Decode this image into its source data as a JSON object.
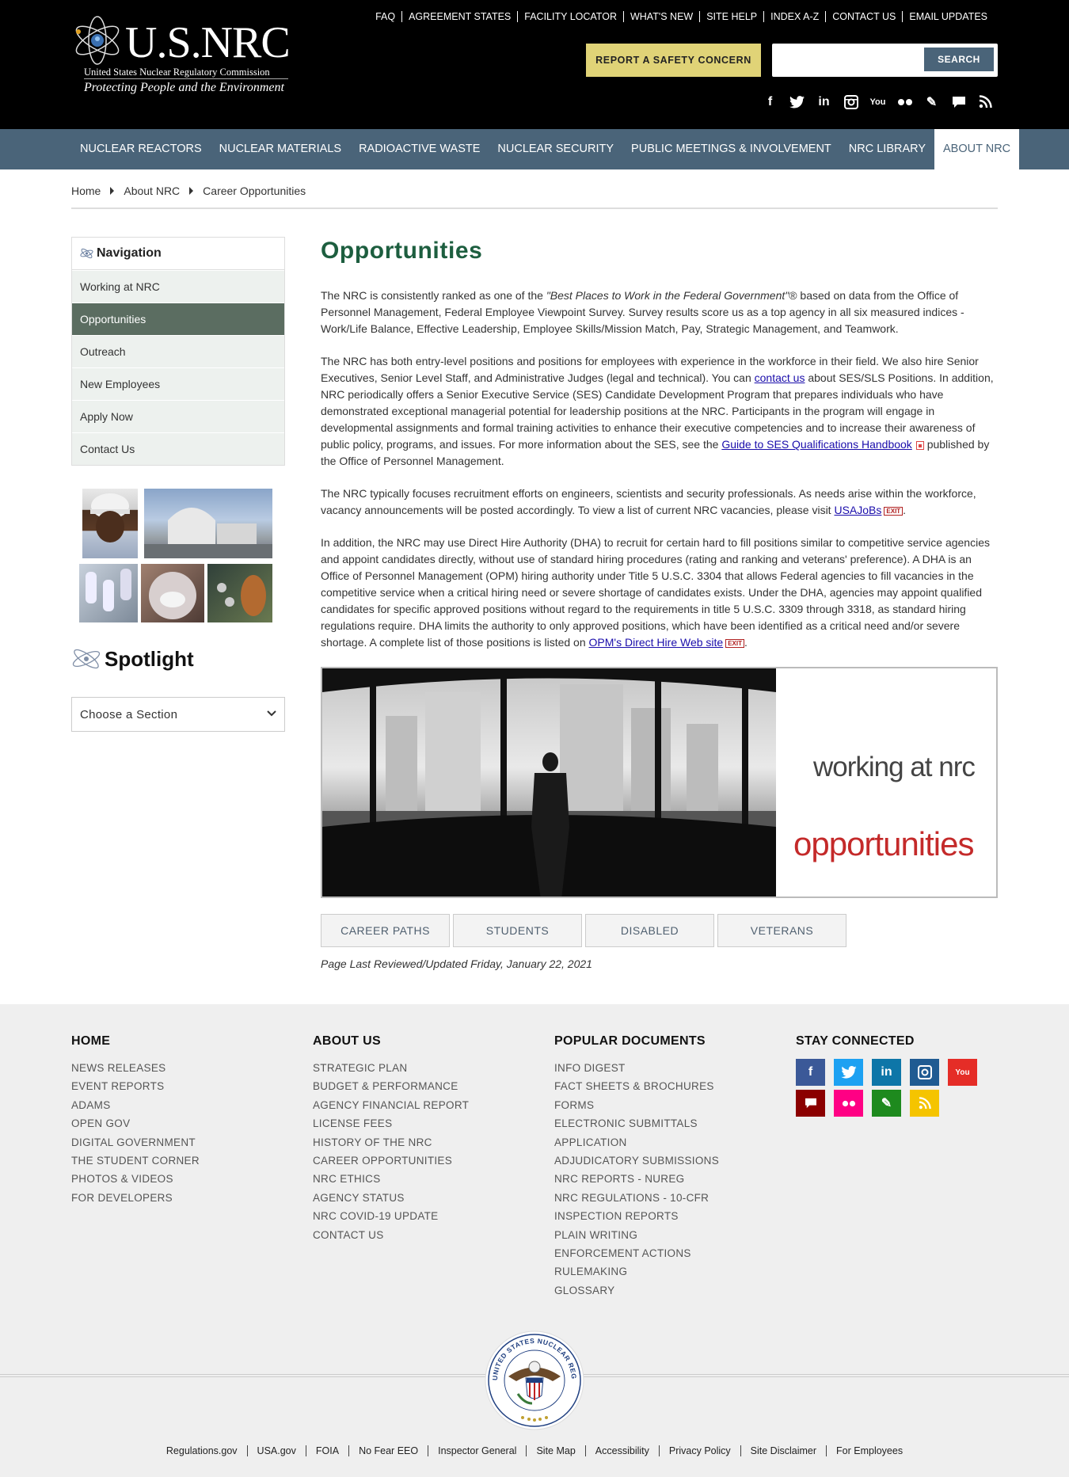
{
  "header": {
    "logo_text": "U.S.NRC",
    "logo_subtitle": "United States Nuclear Regulatory Commission",
    "logo_tagline": "Protecting People and the Environment",
    "util_links": [
      "FAQ",
      "AGREEMENT STATES",
      "FACILITY LOCATOR",
      "WHAT'S NEW",
      "SITE HELP",
      "INDEX A-Z",
      "CONTACT US",
      "EMAIL UPDATES"
    ],
    "report_button": "REPORT A SAFETY CONCERN",
    "search_placeholder": "",
    "search_button": "SEARCH",
    "social_icons": [
      "facebook-icon",
      "twitter-icon",
      "linkedin-icon",
      "instagram-icon",
      "youtube-icon",
      "flickr-icon",
      "blog-pencil-icon",
      "comment-icon",
      "rss-icon"
    ]
  },
  "mainnav": [
    "NUCLEAR REACTORS",
    "NUCLEAR MATERIALS",
    "RADIOACTIVE WASTE",
    "NUCLEAR SECURITY",
    "PUBLIC MEETINGS & INVOLVEMENT",
    "NRC LIBRARY",
    "ABOUT NRC"
  ],
  "breadcrumb": [
    "Home",
    "About NRC",
    "Career Opportunities"
  ],
  "sidebar": {
    "heading": "Navigation",
    "items": [
      "Working at NRC",
      "Opportunities",
      "Outreach",
      "New Employees",
      "Apply Now",
      "Contact Us"
    ],
    "active_index": 1,
    "spotlight": "Spotlight",
    "select_label": "Choose a Section"
  },
  "main": {
    "title": "Opportunities",
    "p1_a": "The NRC is consistently ranked as one of the ",
    "p1_em": "\"Best Places to Work in the Federal Government\"",
    "p1_b": "® based on data from the Office of Personnel Management, Federal Employee Viewpoint Survey. Survey results score us as a top agency in all six measured indices - Work/Life Balance, Effective Leadership, Employee Skills/Mission Match, Pay, Strategic Management, and Teamwork.",
    "p2_a": "The NRC has both entry-level positions and positions for employees with experience in the workforce in their field. We also hire Senior Executives, Senior Level Staff, and Administrative Judges (legal and technical). You can ",
    "p2_link1": "contact us",
    "p2_b": " about SES/SLS Positions. In addition, NRC periodically offers a Senior Executive Service (SES) Candidate Development Program that prepares individuals who have demonstrated exceptional managerial potential for leadership positions at the NRC. Participants in the program will engage in developmental assignments and formal training activities to enhance their executive competencies and to increase their awareness of public policy, programs, and issues. For more information about the SES, see the ",
    "p2_link2": "Guide to SES Qualifications Handbook",
    "p2_c": " published by the Office of Personnel Management.",
    "p3_a": "The NRC typically focuses recruitment efforts on engineers, scientists and security professionals. As needs arise within the workforce, vacancy announcements will be posted accordingly. To view a list of current NRC vacancies, please visit ",
    "p3_link": "USAJoBs",
    "p3_b": ".",
    "p4_a": "In addition, the NRC may use Direct Hire Authority (DHA) to recruit for certain hard to fill positions similar to competitive service agencies and appoint candidates directly, without use of standard hiring procedures (rating and ranking and veterans' preference). A DHA is an Office of Personnel Management (OPM) hiring authority under Title 5 U.S.C. 3304 that allows Federal agencies to fill vacancies in the competitive service when a critical hiring need or severe shortage of candidates exists. Under the DHA, agencies may appoint qualified candidates for specific approved positions without regard to the requirements in title 5 U.S.C. 3309 through 3318, as standard hiring regulations require. DHA limits the authority to only approved positions, which have been identified as a critical need and/or severe shortage. A complete list of those positions is listed on ",
    "p4_link": "OPM's Direct Hire Web site",
    "p4_b": ".",
    "exit_label": "EXIT",
    "banner_line1": "working at nrc",
    "banner_line2": "opportunities",
    "tabs": [
      "CAREER PATHS",
      "STUDENTS",
      "DISABLED",
      "VETERANS"
    ],
    "updated": "Page Last Reviewed/Updated Friday, January 22, 2021"
  },
  "footer": {
    "col1": {
      "title": "HOME",
      "items": [
        "NEWS RELEASES",
        "EVENT REPORTS",
        "ADAMS",
        "OPEN GOV",
        "DIGITAL GOVERNMENT",
        "THE STUDENT CORNER",
        "PHOTOS & VIDEOS",
        "FOR DEVELOPERS"
      ]
    },
    "col2": {
      "title": "ABOUT US",
      "items": [
        "STRATEGIC PLAN",
        "BUDGET & PERFORMANCE",
        "AGENCY FINANCIAL REPORT",
        "LICENSE FEES",
        "HISTORY OF THE NRC",
        "CAREER OPPORTUNITIES",
        "NRC ETHICS",
        "AGENCY STATUS",
        "NRC COVID-19 UPDATE",
        "CONTACT US"
      ]
    },
    "col3": {
      "title": "POPULAR DOCUMENTS",
      "items": [
        "INFO DIGEST",
        "FACT SHEETS & BROCHURES",
        "FORMS",
        "ELECTRONIC SUBMITTALS",
        "APPLICATION",
        "ADJUDICATORY SUBMISSIONS",
        "NRC REPORTS - NUREG",
        "NRC REGULATIONS - 10-CFR",
        "INSPECTION REPORTS",
        "PLAIN WRITING",
        "ENFORCEMENT ACTIONS",
        "RULEMAKING",
        "GLOSSARY"
      ]
    },
    "col4": {
      "title": "STAY CONNECTED"
    },
    "social": [
      {
        "icon": "facebook-icon",
        "glyph": "f",
        "color": "#3b5998"
      },
      {
        "icon": "twitter-icon",
        "glyph": "t",
        "color": "#1da1f2"
      },
      {
        "icon": "linkedin-icon",
        "glyph": "in",
        "color": "#0e76a8"
      },
      {
        "icon": "instagram-icon",
        "glyph": "◎",
        "color": "#1f5b92"
      },
      {
        "icon": "youtube-icon",
        "glyph": "▶",
        "color": "#e52d27"
      },
      {
        "icon": "comment-icon",
        "glyph": "▬",
        "color": "#8b0000"
      },
      {
        "icon": "flickr-icon",
        "glyph": "●●",
        "color": "#ff0084"
      },
      {
        "icon": "blog-pencil-icon",
        "glyph": "✎",
        "color": "#1e8a1e"
      },
      {
        "icon": "rss-icon",
        "glyph": "◔",
        "color": "#f5c400"
      }
    ],
    "seal_text": "UNITED STATES NUCLEAR REGULATORY COMMISSION",
    "bottom_links": [
      "Regulations.gov",
      "USA.gov",
      "FOIA",
      "No Fear EEO",
      "Inspector General",
      "Site Map",
      "Accessibility",
      "Privacy Policy",
      "Site Disclaimer",
      "For Employees"
    ]
  }
}
